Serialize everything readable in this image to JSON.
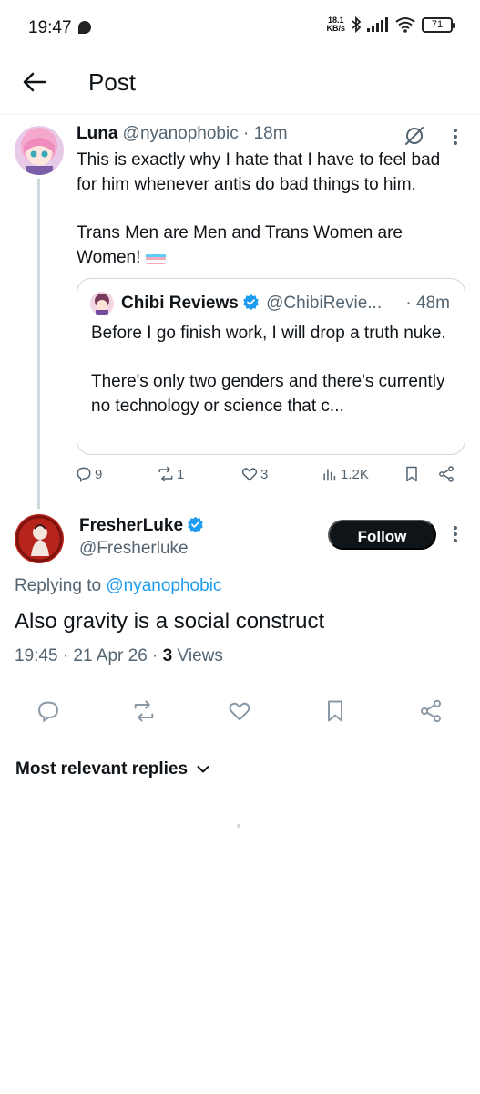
{
  "status_bar": {
    "time": "19:47",
    "net_speed_value": "18.1",
    "net_speed_unit": "KB/s",
    "battery": "71"
  },
  "header": {
    "title": "Post"
  },
  "parent_tweet": {
    "display_name": "Luna",
    "handle": "@nyanophobic",
    "time": "· 18m",
    "text_p1": "This is exactly why I hate that I have to feel bad for him whenever antis do bad things to him.",
    "text_p2": "Trans Men are Men and Trans Women are Women!",
    "quote": {
      "display_name": "Chibi Reviews",
      "handle": "@ChibiRevie...",
      "time": "· 48m",
      "text_p1": "Before I go finish work, I will drop a truth nuke.",
      "text_p2": "There's only two genders and there's currently no technology or science that c..."
    },
    "stats": {
      "replies": "9",
      "reposts": "1",
      "likes": "3",
      "views": "1.2K"
    }
  },
  "main_tweet": {
    "display_name": "FresherLuke",
    "handle": "@Fresherluke",
    "follow_label": "Follow",
    "replying_prefix": "Replying to",
    "replying_handle": "@nyanophobic",
    "text": "Also gravity is a social construct",
    "timestamp": "19:45 · 21 Apr 26 ·",
    "views_count": "3",
    "views_label": "Views"
  },
  "replies_sort": {
    "label": "Most relevant replies"
  },
  "colors": {
    "accent": "#1d9bf0",
    "text": "#0f1419",
    "muted": "#536471",
    "border": "#cfd9de"
  }
}
